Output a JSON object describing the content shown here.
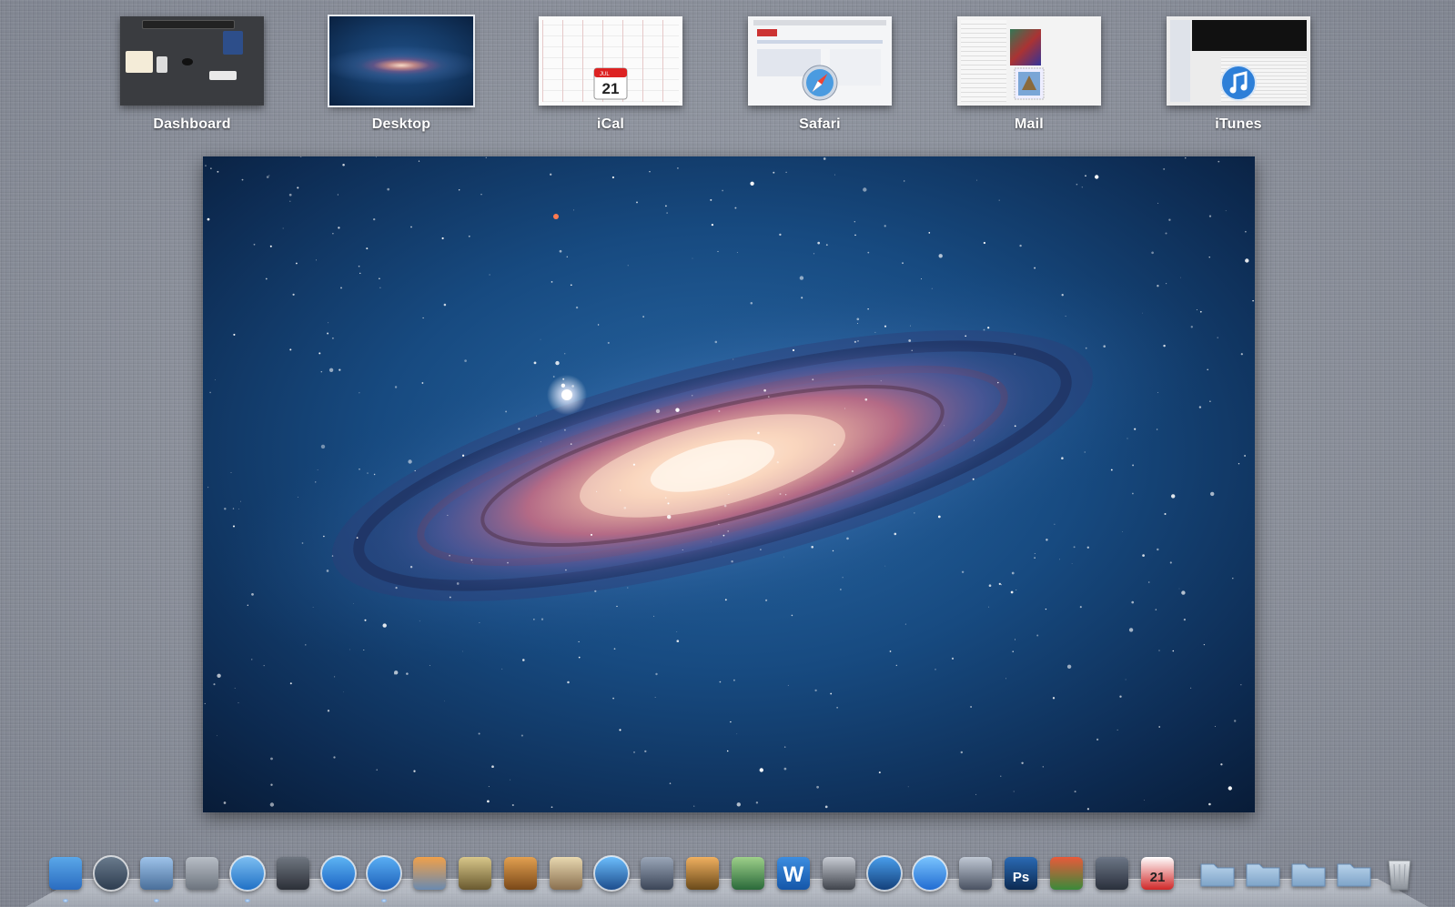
{
  "spaces": [
    {
      "label": "Dashboard",
      "icon": "dashboard-thumbnail"
    },
    {
      "label": "Desktop",
      "icon": "desktop-thumbnail",
      "active": true
    },
    {
      "label": "iCal",
      "icon": "ical-icon",
      "badge_text": "21",
      "badge_month": "JUL"
    },
    {
      "label": "Safari",
      "icon": "safari-icon"
    },
    {
      "label": "Mail",
      "icon": "mail-icon"
    },
    {
      "label": "iTunes",
      "icon": "itunes-icon"
    }
  ],
  "main_preview": {
    "icon": "desktop-wallpaper-galaxy"
  },
  "dock": {
    "apps": [
      {
        "name": "finder-icon"
      },
      {
        "name": "time-machine-icon"
      },
      {
        "name": "mail-stamp-icon"
      },
      {
        "name": "system-preferences-icon"
      },
      {
        "name": "safari-icon"
      },
      {
        "name": "facetime-icon"
      },
      {
        "name": "app-store-icon"
      },
      {
        "name": "itunes-icon"
      },
      {
        "name": "iphoto-icon"
      },
      {
        "name": "imovie-icon"
      },
      {
        "name": "garageband-icon"
      },
      {
        "name": "preview-icon"
      },
      {
        "name": "dvd-player-icon"
      },
      {
        "name": "script-editor-icon"
      },
      {
        "name": "keynote-icon"
      },
      {
        "name": "numbers-icon"
      },
      {
        "name": "word-icon",
        "text": "W"
      },
      {
        "name": "final-cut-icon"
      },
      {
        "name": "quicktime-icon"
      },
      {
        "name": "quicktime-x-icon"
      },
      {
        "name": "photo-search-icon"
      },
      {
        "name": "photoshop-icon",
        "text": "Ps"
      },
      {
        "name": "transmit-icon"
      },
      {
        "name": "steam-icon"
      },
      {
        "name": "ical-dock-icon",
        "text": "21"
      }
    ],
    "folders": [
      {
        "name": "applications-folder-icon"
      },
      {
        "name": "app-store-folder-icon"
      },
      {
        "name": "documents-folder-icon"
      },
      {
        "name": "downloads-folder-icon"
      }
    ],
    "trash": {
      "name": "trash-icon"
    }
  },
  "colors": {
    "desktop_bg": "#8d929d",
    "label_text": "#ffffff",
    "galaxy_deep": "#0a2140",
    "galaxy_core": "#ffe1c8"
  }
}
